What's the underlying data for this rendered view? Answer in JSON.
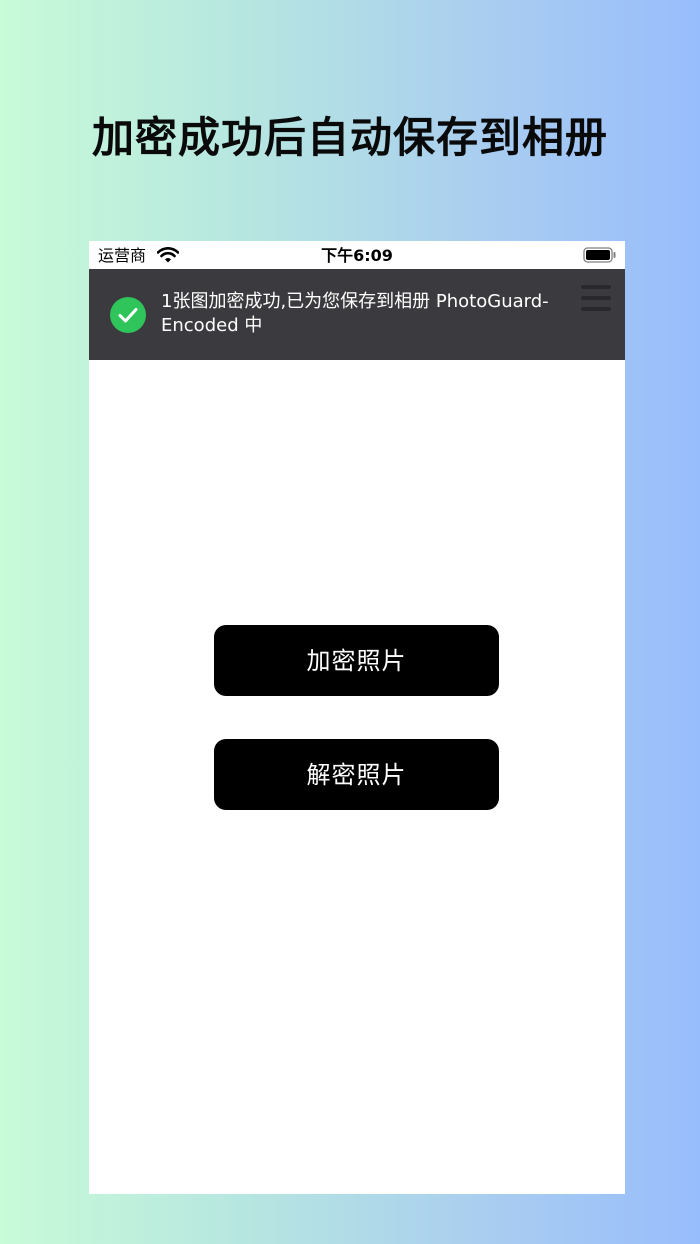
{
  "headline": "加密成功后自动保存到相册",
  "status_bar": {
    "carrier": "运营商",
    "time": "下午6:09"
  },
  "toast": {
    "message": "1张图加密成功,已为您保存到相册 PhotoGuard-Encoded 中",
    "icon": "check-circle-icon",
    "icon_color": "#2fc55a"
  },
  "buttons": {
    "encrypt_label": "加密照片",
    "decrypt_label": "解密照片"
  },
  "colors": {
    "toast_bg": "#3b3b3f",
    "button_bg": "#000000",
    "gradient_left": "#c8fbd8",
    "gradient_right": "#98bdfc"
  }
}
